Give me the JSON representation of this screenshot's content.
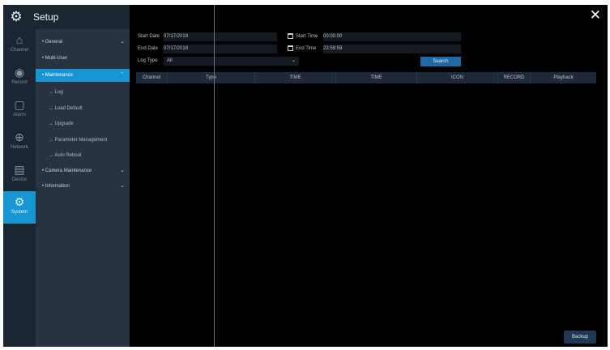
{
  "app": {
    "title": "Setup"
  },
  "sidebar": {
    "items": [
      {
        "label": "Channel",
        "icon": "camera-icon"
      },
      {
        "label": "Record",
        "icon": "record-icon"
      },
      {
        "label": "Alarm",
        "icon": "alarm-icon"
      },
      {
        "label": "Network",
        "icon": "network-icon"
      },
      {
        "label": "Device",
        "icon": "device-icon"
      },
      {
        "label": "System",
        "icon": "system-icon"
      }
    ]
  },
  "menu": {
    "items": [
      {
        "label": "• General"
      },
      {
        "label": "• Multi-User"
      },
      {
        "label": "• Maintenance"
      },
      {
        "label": "→ Log"
      },
      {
        "label": "→ Load Default"
      },
      {
        "label": "→ Upgrade"
      },
      {
        "label": "→ Parameter Management"
      },
      {
        "label": "→ Auto Reboot"
      },
      {
        "label": "• Camera Maintenance"
      },
      {
        "label": "• Information"
      }
    ]
  },
  "filters": {
    "start_date_label": "Start Date",
    "start_date": "07/17/2018",
    "end_date_label": "End Date",
    "end_date": "07/17/2018",
    "start_time_label": "Start Time",
    "start_time": "00:00:00",
    "end_time_label": "End Time",
    "end_time": "23:59:59",
    "log_type_label": "Log Type",
    "log_type": "All",
    "search_label": "Search"
  },
  "table": {
    "columns": [
      "Channel",
      "Type",
      "TIME",
      "TIME",
      "ICON",
      "RECORD",
      "Playback"
    ]
  },
  "footer": {
    "backup_label": "Backup"
  },
  "colors": {
    "accent": "#1797d1",
    "sidebar": "#1b2633",
    "menu": "#29333f"
  }
}
